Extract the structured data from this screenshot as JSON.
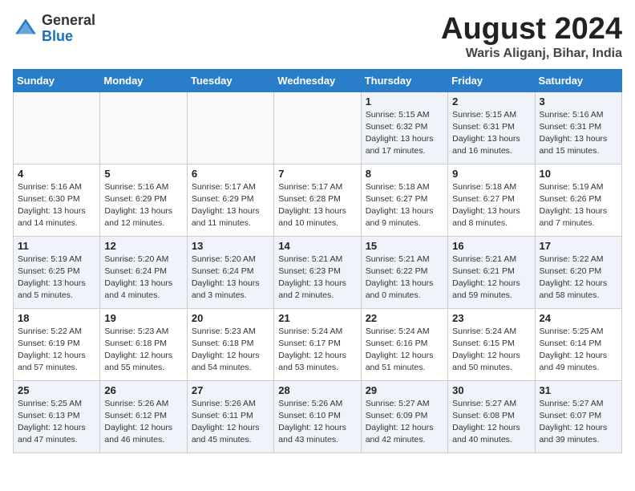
{
  "logo": {
    "line1": "General",
    "line2": "Blue"
  },
  "title": "August 2024",
  "subtitle": "Waris Aliganj, Bihar, India",
  "weekdays": [
    "Sunday",
    "Monday",
    "Tuesday",
    "Wednesday",
    "Thursday",
    "Friday",
    "Saturday"
  ],
  "weeks": [
    [
      {
        "day": "",
        "info": ""
      },
      {
        "day": "",
        "info": ""
      },
      {
        "day": "",
        "info": ""
      },
      {
        "day": "",
        "info": ""
      },
      {
        "day": "1",
        "info": "Sunrise: 5:15 AM\nSunset: 6:32 PM\nDaylight: 13 hours\nand 17 minutes."
      },
      {
        "day": "2",
        "info": "Sunrise: 5:15 AM\nSunset: 6:31 PM\nDaylight: 13 hours\nand 16 minutes."
      },
      {
        "day": "3",
        "info": "Sunrise: 5:16 AM\nSunset: 6:31 PM\nDaylight: 13 hours\nand 15 minutes."
      }
    ],
    [
      {
        "day": "4",
        "info": "Sunrise: 5:16 AM\nSunset: 6:30 PM\nDaylight: 13 hours\nand 14 minutes."
      },
      {
        "day": "5",
        "info": "Sunrise: 5:16 AM\nSunset: 6:29 PM\nDaylight: 13 hours\nand 12 minutes."
      },
      {
        "day": "6",
        "info": "Sunrise: 5:17 AM\nSunset: 6:29 PM\nDaylight: 13 hours\nand 11 minutes."
      },
      {
        "day": "7",
        "info": "Sunrise: 5:17 AM\nSunset: 6:28 PM\nDaylight: 13 hours\nand 10 minutes."
      },
      {
        "day": "8",
        "info": "Sunrise: 5:18 AM\nSunset: 6:27 PM\nDaylight: 13 hours\nand 9 minutes."
      },
      {
        "day": "9",
        "info": "Sunrise: 5:18 AM\nSunset: 6:27 PM\nDaylight: 13 hours\nand 8 minutes."
      },
      {
        "day": "10",
        "info": "Sunrise: 5:19 AM\nSunset: 6:26 PM\nDaylight: 13 hours\nand 7 minutes."
      }
    ],
    [
      {
        "day": "11",
        "info": "Sunrise: 5:19 AM\nSunset: 6:25 PM\nDaylight: 13 hours\nand 5 minutes."
      },
      {
        "day": "12",
        "info": "Sunrise: 5:20 AM\nSunset: 6:24 PM\nDaylight: 13 hours\nand 4 minutes."
      },
      {
        "day": "13",
        "info": "Sunrise: 5:20 AM\nSunset: 6:24 PM\nDaylight: 13 hours\nand 3 minutes."
      },
      {
        "day": "14",
        "info": "Sunrise: 5:21 AM\nSunset: 6:23 PM\nDaylight: 13 hours\nand 2 minutes."
      },
      {
        "day": "15",
        "info": "Sunrise: 5:21 AM\nSunset: 6:22 PM\nDaylight: 13 hours\nand 0 minutes."
      },
      {
        "day": "16",
        "info": "Sunrise: 5:21 AM\nSunset: 6:21 PM\nDaylight: 12 hours\nand 59 minutes."
      },
      {
        "day": "17",
        "info": "Sunrise: 5:22 AM\nSunset: 6:20 PM\nDaylight: 12 hours\nand 58 minutes."
      }
    ],
    [
      {
        "day": "18",
        "info": "Sunrise: 5:22 AM\nSunset: 6:19 PM\nDaylight: 12 hours\nand 57 minutes."
      },
      {
        "day": "19",
        "info": "Sunrise: 5:23 AM\nSunset: 6:18 PM\nDaylight: 12 hours\nand 55 minutes."
      },
      {
        "day": "20",
        "info": "Sunrise: 5:23 AM\nSunset: 6:18 PM\nDaylight: 12 hours\nand 54 minutes."
      },
      {
        "day": "21",
        "info": "Sunrise: 5:24 AM\nSunset: 6:17 PM\nDaylight: 12 hours\nand 53 minutes."
      },
      {
        "day": "22",
        "info": "Sunrise: 5:24 AM\nSunset: 6:16 PM\nDaylight: 12 hours\nand 51 minutes."
      },
      {
        "day": "23",
        "info": "Sunrise: 5:24 AM\nSunset: 6:15 PM\nDaylight: 12 hours\nand 50 minutes."
      },
      {
        "day": "24",
        "info": "Sunrise: 5:25 AM\nSunset: 6:14 PM\nDaylight: 12 hours\nand 49 minutes."
      }
    ],
    [
      {
        "day": "25",
        "info": "Sunrise: 5:25 AM\nSunset: 6:13 PM\nDaylight: 12 hours\nand 47 minutes."
      },
      {
        "day": "26",
        "info": "Sunrise: 5:26 AM\nSunset: 6:12 PM\nDaylight: 12 hours\nand 46 minutes."
      },
      {
        "day": "27",
        "info": "Sunrise: 5:26 AM\nSunset: 6:11 PM\nDaylight: 12 hours\nand 45 minutes."
      },
      {
        "day": "28",
        "info": "Sunrise: 5:26 AM\nSunset: 6:10 PM\nDaylight: 12 hours\nand 43 minutes."
      },
      {
        "day": "29",
        "info": "Sunrise: 5:27 AM\nSunset: 6:09 PM\nDaylight: 12 hours\nand 42 minutes."
      },
      {
        "day": "30",
        "info": "Sunrise: 5:27 AM\nSunset: 6:08 PM\nDaylight: 12 hours\nand 40 minutes."
      },
      {
        "day": "31",
        "info": "Sunrise: 5:27 AM\nSunset: 6:07 PM\nDaylight: 12 hours\nand 39 minutes."
      }
    ]
  ]
}
